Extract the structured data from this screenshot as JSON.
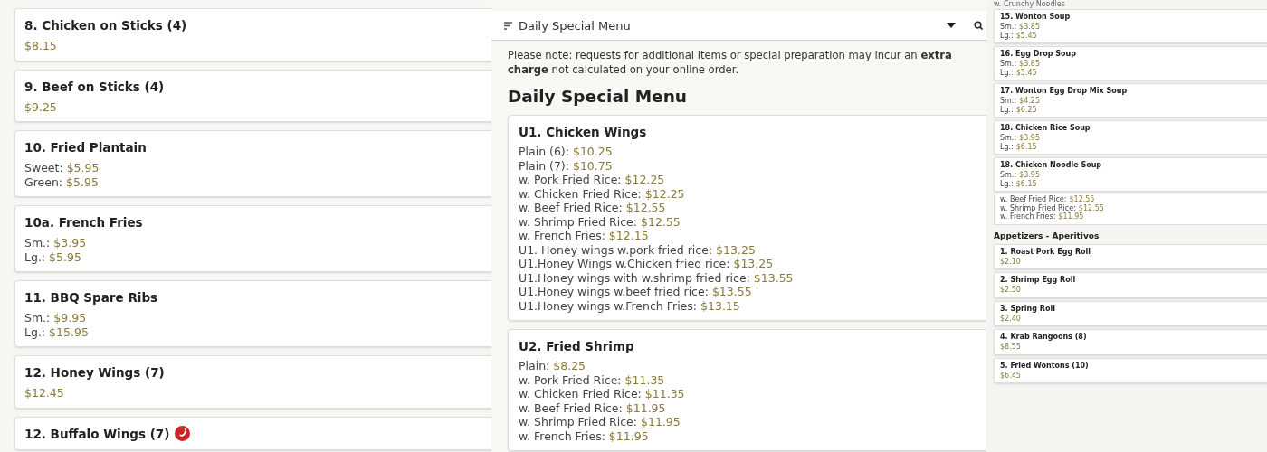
{
  "left": {
    "items": [
      {
        "name": "8. Chicken on Sticks (4)",
        "spicy": false,
        "prices": [
          {
            "price": "$8.15"
          }
        ]
      },
      {
        "name": "9. Beef on Sticks (4)",
        "spicy": false,
        "prices": [
          {
            "price": "$9.25"
          }
        ]
      },
      {
        "name": "10. Fried Plantain",
        "spicy": false,
        "prices": [
          {
            "label": "Sweet:",
            "price": "$5.95"
          },
          {
            "label": "Green:",
            "price": "$5.95"
          }
        ]
      },
      {
        "name": "10a. French Fries",
        "spicy": false,
        "prices": [
          {
            "label": "Sm.:",
            "price": "$3.95"
          },
          {
            "label": "Lg.:",
            "price": "$5.95"
          }
        ]
      },
      {
        "name": "11. BBQ Spare Ribs",
        "spicy": false,
        "prices": [
          {
            "label": "Sm.:",
            "price": "$9.95"
          },
          {
            "label": "Lg.:",
            "price": "$15.95"
          }
        ]
      },
      {
        "name": "12. Honey Wings (7)",
        "spicy": false,
        "prices": [
          {
            "price": "$12.45"
          }
        ]
      },
      {
        "name": "12. Buffalo Wings (7)",
        "spicy": true
      }
    ]
  },
  "middle": {
    "header": {
      "title": "Daily Special Menu"
    },
    "note": "Please note: requests for additional items or special preparation may incur an **extra charge** not calculated on your online order.",
    "section_title": "Daily Special Menu",
    "items": [
      {
        "name": "U1. Chicken Wings",
        "prices": [
          {
            "label": "Plain (6):",
            "price": "$10.25"
          },
          {
            "label": "Plain (7):",
            "price": "$10.75"
          },
          {
            "label": "w. Pork Fried Rice:",
            "price": "$12.25"
          },
          {
            "label": "w. Chicken Fried Rice:",
            "price": "$12.25"
          },
          {
            "label": "w. Beef Fried Rice:",
            "price": "$12.55"
          },
          {
            "label": "w. Shrimp Fried Rice:",
            "price": "$12.55"
          },
          {
            "label": "w. French Fries:",
            "price": "$12.15"
          },
          {
            "label": "U1. Honey wings w.pork fried rice:",
            "price": "$13.25"
          },
          {
            "label": "U1.Honey Wings w.Chicken fried rice:",
            "price": "$13.25"
          },
          {
            "label": "U1.Honey wings with w.shrimp fried rice:",
            "price": "$13.55"
          },
          {
            "label": "U1.Honey wings w.beef fried rice:",
            "price": "$13.55"
          },
          {
            "label": "U1.Honey wings w.French Fries:",
            "price": "$13.15"
          }
        ]
      },
      {
        "name": "U2. Fried Shrimp",
        "prices": [
          {
            "label": "Plain:",
            "price": "$8.25"
          },
          {
            "label": "w. Pork Fried Rice:",
            "price": "$11.35"
          },
          {
            "label": "w. Chicken Fried Rice:",
            "price": "$11.35"
          },
          {
            "label": "w. Beef Fried Rice:",
            "price": "$11.95"
          },
          {
            "label": "w. Shrimp Fried Rice:",
            "price": "$11.95"
          },
          {
            "label": "w. French Fries:",
            "price": "$11.95"
          }
        ]
      }
    ]
  },
  "right": {
    "top_note": "w. Crunchy Noodles",
    "soups": [
      {
        "name": "15. Wonton Soup",
        "prices": [
          {
            "label": "Sm.:",
            "price": "$3.85"
          },
          {
            "label": "Lg.:",
            "price": "$5.45"
          }
        ]
      },
      {
        "name": "16. Egg Drop Soup",
        "prices": [
          {
            "label": "Sm.:",
            "price": "$3.85"
          },
          {
            "label": "Lg.:",
            "price": "$5.45"
          }
        ]
      },
      {
        "name": "17. Wonton Egg Drop Mix Soup",
        "prices": [
          {
            "label": "Sm.:",
            "price": "$4.25"
          },
          {
            "label": "Lg.:",
            "price": "$6.25"
          }
        ]
      },
      {
        "name": "18. Chicken Rice Soup",
        "prices": [
          {
            "label": "Sm.:",
            "price": "$3.95"
          },
          {
            "label": "Lg.:",
            "price": "$6.15"
          }
        ]
      },
      {
        "name": "18. Chicken Noodle Soup",
        "prices": [
          {
            "label": "Sm.:",
            "price": "$3.95"
          },
          {
            "label": "Lg.:",
            "price": "$6.15"
          }
        ]
      }
    ],
    "fragment": [
      {
        "label": "w. Beef Fried Rice:",
        "price": "$12.55"
      },
      {
        "label": "w. Shrimp Fried Rice:",
        "price": "$12.55"
      },
      {
        "label": "w. French Fries:",
        "price": "$11.95"
      }
    ],
    "section_title": "Appetizers - Aperitivos",
    "items": [
      {
        "name": "1. Roast Pork Egg Roll",
        "prices": [
          {
            "price": "$2.10"
          }
        ]
      },
      {
        "name": "2. Shrimp Egg Roll",
        "prices": [
          {
            "price": "$2.50"
          }
        ]
      },
      {
        "name": "3. Spring Roll",
        "prices": [
          {
            "price": "$2.40"
          }
        ]
      },
      {
        "name": "4. Krab Rangoons (8)",
        "prices": [
          {
            "price": "$8.55"
          }
        ]
      },
      {
        "name": "5. Fried Wontons (10)",
        "prices": [
          {
            "price": "$6.45"
          }
        ]
      }
    ]
  }
}
